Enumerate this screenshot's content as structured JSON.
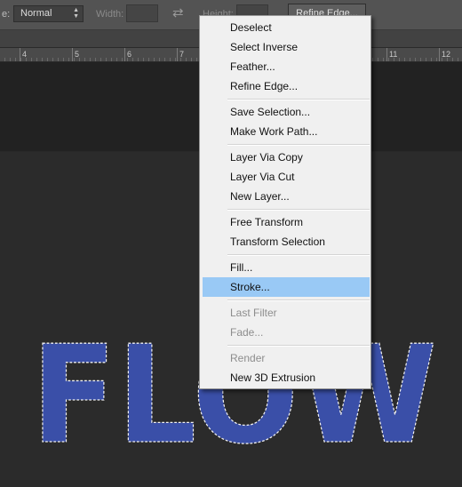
{
  "options_bar": {
    "style_label": "e:",
    "style_value": "Normal",
    "width_label": "Width:",
    "height_label": "Height:",
    "refine_edge_button": "Refine Edge..."
  },
  "ruler": {
    "numbers": [
      "4",
      "5",
      "6",
      "7",
      "11",
      "12"
    ]
  },
  "canvas": {
    "text": "FLOW",
    "text_color": "#3a4fa8",
    "selection_border": "marching-ants"
  },
  "context_menu": {
    "groups": [
      [
        {
          "label": "Deselect",
          "enabled": true
        },
        {
          "label": "Select Inverse",
          "enabled": true
        },
        {
          "label": "Feather...",
          "enabled": true
        },
        {
          "label": "Refine Edge...",
          "enabled": true
        }
      ],
      [
        {
          "label": "Save Selection...",
          "enabled": true
        },
        {
          "label": "Make Work Path...",
          "enabled": true
        }
      ],
      [
        {
          "label": "Layer Via Copy",
          "enabled": true
        },
        {
          "label": "Layer Via Cut",
          "enabled": true
        },
        {
          "label": "New Layer...",
          "enabled": true
        }
      ],
      [
        {
          "label": "Free Transform",
          "enabled": true
        },
        {
          "label": "Transform Selection",
          "enabled": true
        }
      ],
      [
        {
          "label": "Fill...",
          "enabled": true
        },
        {
          "label": "Stroke...",
          "enabled": true,
          "highlighted": true
        }
      ],
      [
        {
          "label": "Last Filter",
          "enabled": false
        },
        {
          "label": "Fade...",
          "enabled": false
        }
      ],
      [
        {
          "label": "Render",
          "enabled": false
        },
        {
          "label": "New 3D Extrusion",
          "enabled": true
        }
      ]
    ],
    "highlight_color": "#99c9f5"
  }
}
